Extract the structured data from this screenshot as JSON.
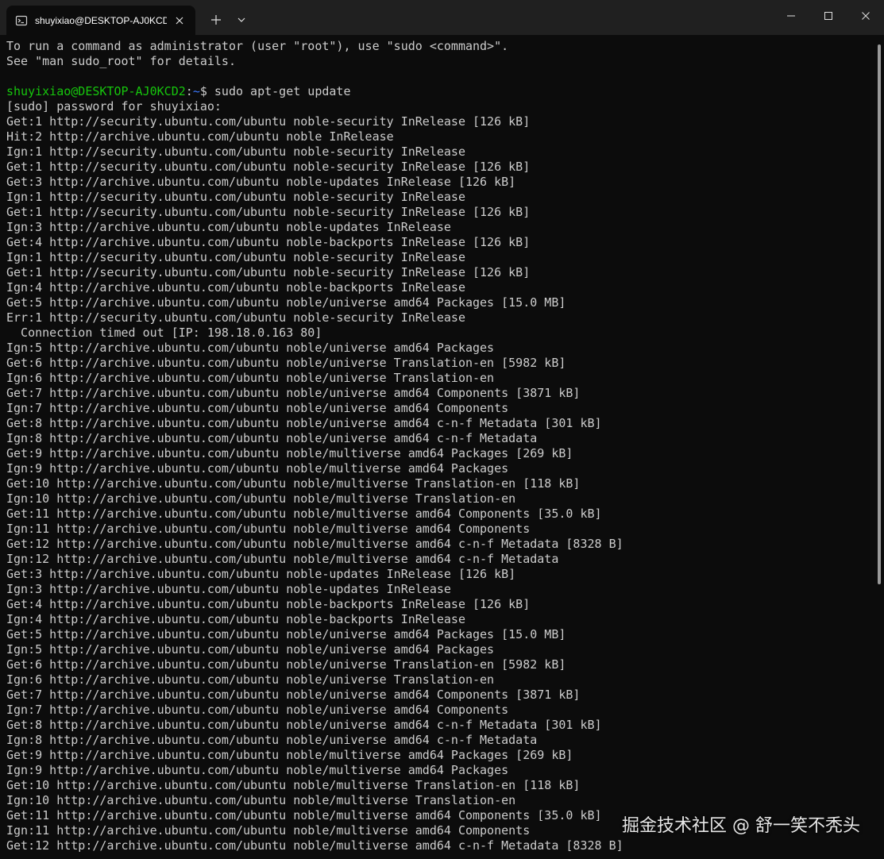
{
  "window": {
    "tab_title": "shuyixiao@DESKTOP-AJ0KCD2: ~",
    "accent_color": "#16c60c",
    "path_color": "#3b78ff"
  },
  "terminal": {
    "lines": [
      "To run a command as administrator (user \"root\"), use \"sudo <command>\".",
      "See \"man sudo_root\" for details.",
      "",
      null,
      "[sudo] password for shuyixiao:",
      "Get:1 http://security.ubuntu.com/ubuntu noble-security InRelease [126 kB]",
      "Hit:2 http://archive.ubuntu.com/ubuntu noble InRelease",
      "Ign:1 http://security.ubuntu.com/ubuntu noble-security InRelease",
      "Get:1 http://security.ubuntu.com/ubuntu noble-security InRelease [126 kB]",
      "Get:3 http://archive.ubuntu.com/ubuntu noble-updates InRelease [126 kB]",
      "Ign:1 http://security.ubuntu.com/ubuntu noble-security InRelease",
      "Get:1 http://security.ubuntu.com/ubuntu noble-security InRelease [126 kB]",
      "Ign:3 http://archive.ubuntu.com/ubuntu noble-updates InRelease",
      "Get:4 http://archive.ubuntu.com/ubuntu noble-backports InRelease [126 kB]",
      "Ign:1 http://security.ubuntu.com/ubuntu noble-security InRelease",
      "Get:1 http://security.ubuntu.com/ubuntu noble-security InRelease [126 kB]",
      "Ign:4 http://archive.ubuntu.com/ubuntu noble-backports InRelease",
      "Get:5 http://archive.ubuntu.com/ubuntu noble/universe amd64 Packages [15.0 MB]",
      "Err:1 http://security.ubuntu.com/ubuntu noble-security InRelease",
      "  Connection timed out [IP: 198.18.0.163 80]",
      "Ign:5 http://archive.ubuntu.com/ubuntu noble/universe amd64 Packages",
      "Get:6 http://archive.ubuntu.com/ubuntu noble/universe Translation-en [5982 kB]",
      "Ign:6 http://archive.ubuntu.com/ubuntu noble/universe Translation-en",
      "Get:7 http://archive.ubuntu.com/ubuntu noble/universe amd64 Components [3871 kB]",
      "Ign:7 http://archive.ubuntu.com/ubuntu noble/universe amd64 Components",
      "Get:8 http://archive.ubuntu.com/ubuntu noble/universe amd64 c-n-f Metadata [301 kB]",
      "Ign:8 http://archive.ubuntu.com/ubuntu noble/universe amd64 c-n-f Metadata",
      "Get:9 http://archive.ubuntu.com/ubuntu noble/multiverse amd64 Packages [269 kB]",
      "Ign:9 http://archive.ubuntu.com/ubuntu noble/multiverse amd64 Packages",
      "Get:10 http://archive.ubuntu.com/ubuntu noble/multiverse Translation-en [118 kB]",
      "Ign:10 http://archive.ubuntu.com/ubuntu noble/multiverse Translation-en",
      "Get:11 http://archive.ubuntu.com/ubuntu noble/multiverse amd64 Components [35.0 kB]",
      "Ign:11 http://archive.ubuntu.com/ubuntu noble/multiverse amd64 Components",
      "Get:12 http://archive.ubuntu.com/ubuntu noble/multiverse amd64 c-n-f Metadata [8328 B]",
      "Ign:12 http://archive.ubuntu.com/ubuntu noble/multiverse amd64 c-n-f Metadata",
      "Get:3 http://archive.ubuntu.com/ubuntu noble-updates InRelease [126 kB]",
      "Ign:3 http://archive.ubuntu.com/ubuntu noble-updates InRelease",
      "Get:4 http://archive.ubuntu.com/ubuntu noble-backports InRelease [126 kB]",
      "Ign:4 http://archive.ubuntu.com/ubuntu noble-backports InRelease",
      "Get:5 http://archive.ubuntu.com/ubuntu noble/universe amd64 Packages [15.0 MB]",
      "Ign:5 http://archive.ubuntu.com/ubuntu noble/universe amd64 Packages",
      "Get:6 http://archive.ubuntu.com/ubuntu noble/universe Translation-en [5982 kB]",
      "Ign:6 http://archive.ubuntu.com/ubuntu noble/universe Translation-en",
      "Get:7 http://archive.ubuntu.com/ubuntu noble/universe amd64 Components [3871 kB]",
      "Ign:7 http://archive.ubuntu.com/ubuntu noble/universe amd64 Components",
      "Get:8 http://archive.ubuntu.com/ubuntu noble/universe amd64 c-n-f Metadata [301 kB]",
      "Ign:8 http://archive.ubuntu.com/ubuntu noble/universe amd64 c-n-f Metadata",
      "Get:9 http://archive.ubuntu.com/ubuntu noble/multiverse amd64 Packages [269 kB]",
      "Ign:9 http://archive.ubuntu.com/ubuntu noble/multiverse amd64 Packages",
      "Get:10 http://archive.ubuntu.com/ubuntu noble/multiverse Translation-en [118 kB]",
      "Ign:10 http://archive.ubuntu.com/ubuntu noble/multiverse Translation-en",
      "Get:11 http://archive.ubuntu.com/ubuntu noble/multiverse amd64 Components [35.0 kB]",
      "Ign:11 http://archive.ubuntu.com/ubuntu noble/multiverse amd64 Components",
      "Get:12 http://archive.ubuntu.com/ubuntu noble/multiverse amd64 c-n-f Metadata [8328 B]"
    ],
    "prompt": {
      "user_host": "shuyixiao@DESKTOP-AJ0KCD2",
      "separator": ":",
      "path": "~",
      "symbol": "$ ",
      "command": "sudo apt-get update"
    }
  },
  "watermark": "掘金技术社区 @ 舒一笑不秃头"
}
